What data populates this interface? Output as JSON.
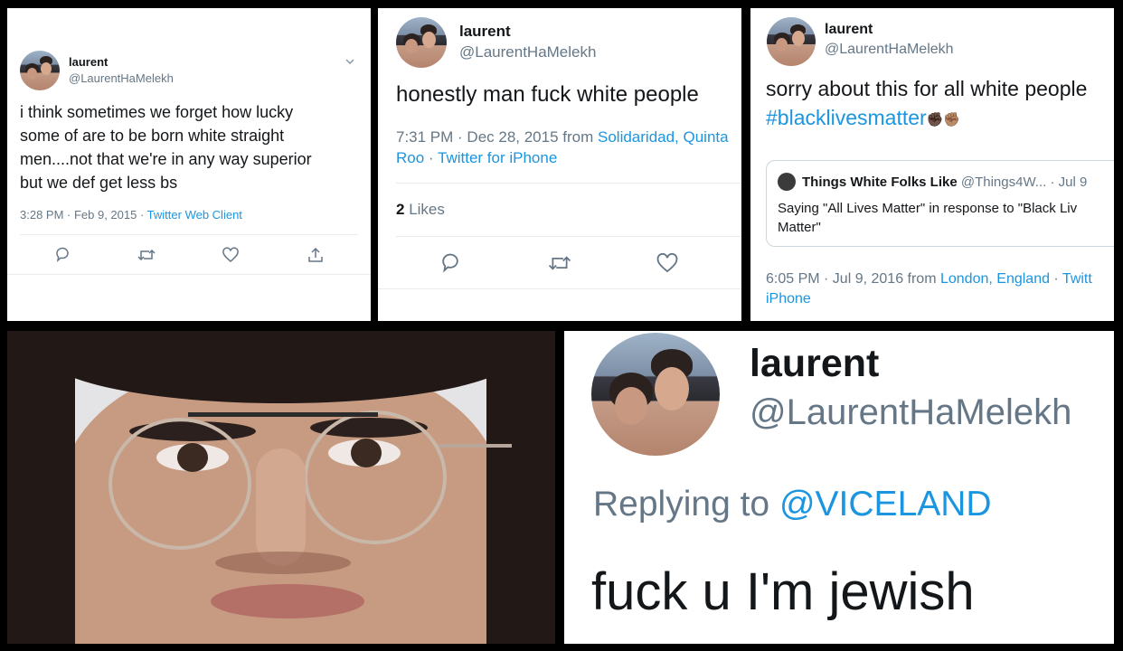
{
  "tweet1": {
    "name": "laurent",
    "handle": "@LaurentHaMelekh",
    "lines": [
      "i think sometimes we forget how lucky",
      "some of are to be born white straight",
      "men....not that we're in any way superior",
      "but we def get less bs"
    ],
    "time": "3:28 PM · Feb 9, 2015 · ",
    "client": "Twitter Web Client"
  },
  "tweet2": {
    "name": "laurent",
    "handle": "@LaurentHaMelekh",
    "text": "honestly man fuck white people",
    "time": "7:31 PM · Dec 28, 2015 from ",
    "location": "Solidaridad, Quinta",
    "location2": "Roo",
    "client_sep": " · ",
    "client": "Twitter for iPhone",
    "likes_count": "2",
    "likes_label": " Likes"
  },
  "tweet3": {
    "name": "laurent",
    "handle": "@LaurentHaMelekh",
    "text": "sorry about this for all white people",
    "hashtag": "#blacklivesmatter",
    "emoji": "✊🏿✊🏽",
    "quote": {
      "name": "Things White Folks Like",
      "handle": "@Things4W...",
      "date": "· Jul 9",
      "text_line1": "Saying \"All Lives Matter\" in response to \"Black Liv",
      "text_line2": "Matter\""
    },
    "time": "6:05 PM · Jul 9, 2016 from ",
    "location": "London, England",
    "client_sep": " · ",
    "client": "Twitt",
    "client2": "iPhone"
  },
  "tweet5": {
    "name": "laurent",
    "handle": "@LaurentHaMelekh",
    "reply_prefix": "Replying to ",
    "reply_to": "@VICELAND",
    "text": "fuck u I'm jewish"
  },
  "colors": {
    "link": "#1b95e0",
    "muted": "#657786",
    "text": "#14171a"
  }
}
